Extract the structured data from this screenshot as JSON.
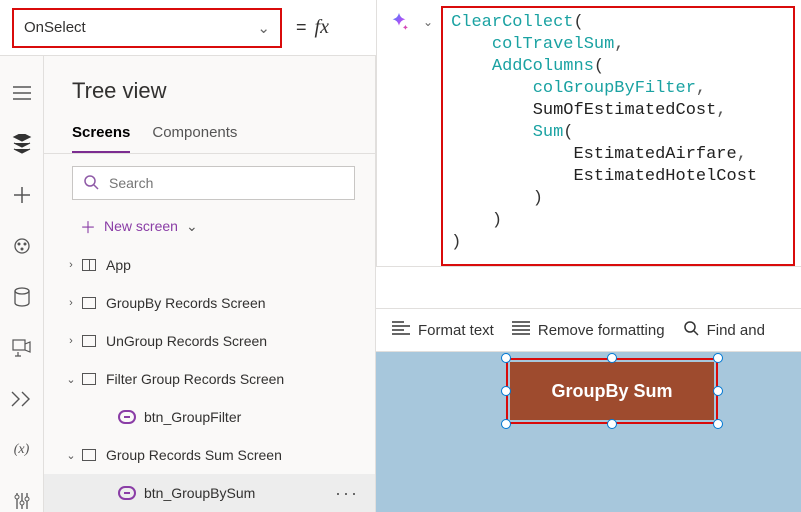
{
  "property_dropdown": {
    "value": "OnSelect"
  },
  "formula_tokens": [
    [
      {
        "t": "ClearCollect",
        "c": "tok-fn"
      },
      {
        "t": "(",
        "c": "tok-paren"
      }
    ],
    [
      {
        "t": "    ",
        "c": ""
      },
      {
        "t": "colTravelSum",
        "c": "tok-var"
      },
      {
        "t": ",",
        "c": "tok-comma"
      }
    ],
    [
      {
        "t": "    ",
        "c": ""
      },
      {
        "t": "AddColumns",
        "c": "tok-fn"
      },
      {
        "t": "(",
        "c": "tok-paren"
      }
    ],
    [
      {
        "t": "        ",
        "c": ""
      },
      {
        "t": "colGroupByFilter",
        "c": "tok-var"
      },
      {
        "t": ",",
        "c": "tok-comma"
      }
    ],
    [
      {
        "t": "        ",
        "c": ""
      },
      {
        "t": "SumOfEstimatedCost",
        "c": "tok-id"
      },
      {
        "t": ",",
        "c": "tok-comma"
      }
    ],
    [
      {
        "t": "        ",
        "c": ""
      },
      {
        "t": "Sum",
        "c": "tok-fn"
      },
      {
        "t": "(",
        "c": "tok-paren"
      }
    ],
    [
      {
        "t": "            ",
        "c": ""
      },
      {
        "t": "EstimatedAirfare",
        "c": "tok-id"
      },
      {
        "t": ",",
        "c": "tok-comma"
      }
    ],
    [
      {
        "t": "            ",
        "c": ""
      },
      {
        "t": "EstimatedHotelCost",
        "c": "tok-id"
      }
    ],
    [
      {
        "t": "        ",
        "c": ""
      },
      {
        "t": ")",
        "c": "tok-paren"
      }
    ],
    [
      {
        "t": "    ",
        "c": ""
      },
      {
        "t": ")",
        "c": "tok-paren"
      }
    ],
    [
      {
        "t": ")",
        "c": "tok-paren"
      }
    ]
  ],
  "treeview": {
    "title": "Tree view",
    "tabs": {
      "screens": "Screens",
      "components": "Components"
    },
    "search_placeholder": "Search",
    "new_screen": "New screen",
    "nodes": [
      {
        "label": "App",
        "icon": "app",
        "depth": 0,
        "exp": "›"
      },
      {
        "label": "GroupBy Records Screen",
        "icon": "screen",
        "depth": 1,
        "exp": "›"
      },
      {
        "label": "UnGroup Records Screen",
        "icon": "screen",
        "depth": 1,
        "exp": "›"
      },
      {
        "label": "Filter Group Records Screen",
        "icon": "screen",
        "depth": 1,
        "exp": "⌄"
      },
      {
        "label": "btn_GroupFilter",
        "icon": "button",
        "depth": 2,
        "exp": ""
      },
      {
        "label": "Group Records Sum Screen",
        "icon": "screen",
        "depth": 1,
        "exp": "⌄"
      },
      {
        "label": "btn_GroupBySum",
        "icon": "button",
        "depth": 2,
        "exp": "",
        "selected": true
      }
    ]
  },
  "format_toolbar": {
    "format": "Format text",
    "remove": "Remove formatting",
    "find": "Find and"
  },
  "canvas": {
    "selected_button_label": "GroupBy Sum"
  },
  "icons": {
    "equals": "=",
    "fx": "fx"
  }
}
